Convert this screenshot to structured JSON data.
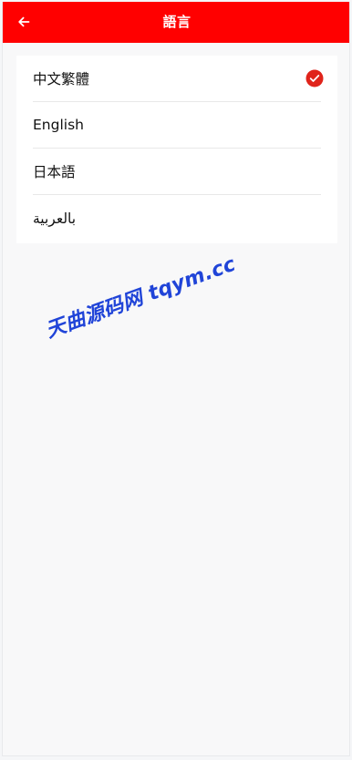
{
  "header": {
    "title": "語言",
    "background_color": "#ff0000",
    "back_icon": "arrow-left-icon"
  },
  "languages": [
    {
      "label": "中文繁體",
      "selected": true
    },
    {
      "label": "English",
      "selected": false
    },
    {
      "label": "日本語",
      "selected": false
    },
    {
      "label": "بالعربية",
      "selected": false
    }
  ],
  "selected_icon": "check-circle-icon",
  "accent_color": "#e0241b",
  "watermark": {
    "text": "天曲源码网 tqym.cc",
    "color": "#2044d8"
  }
}
